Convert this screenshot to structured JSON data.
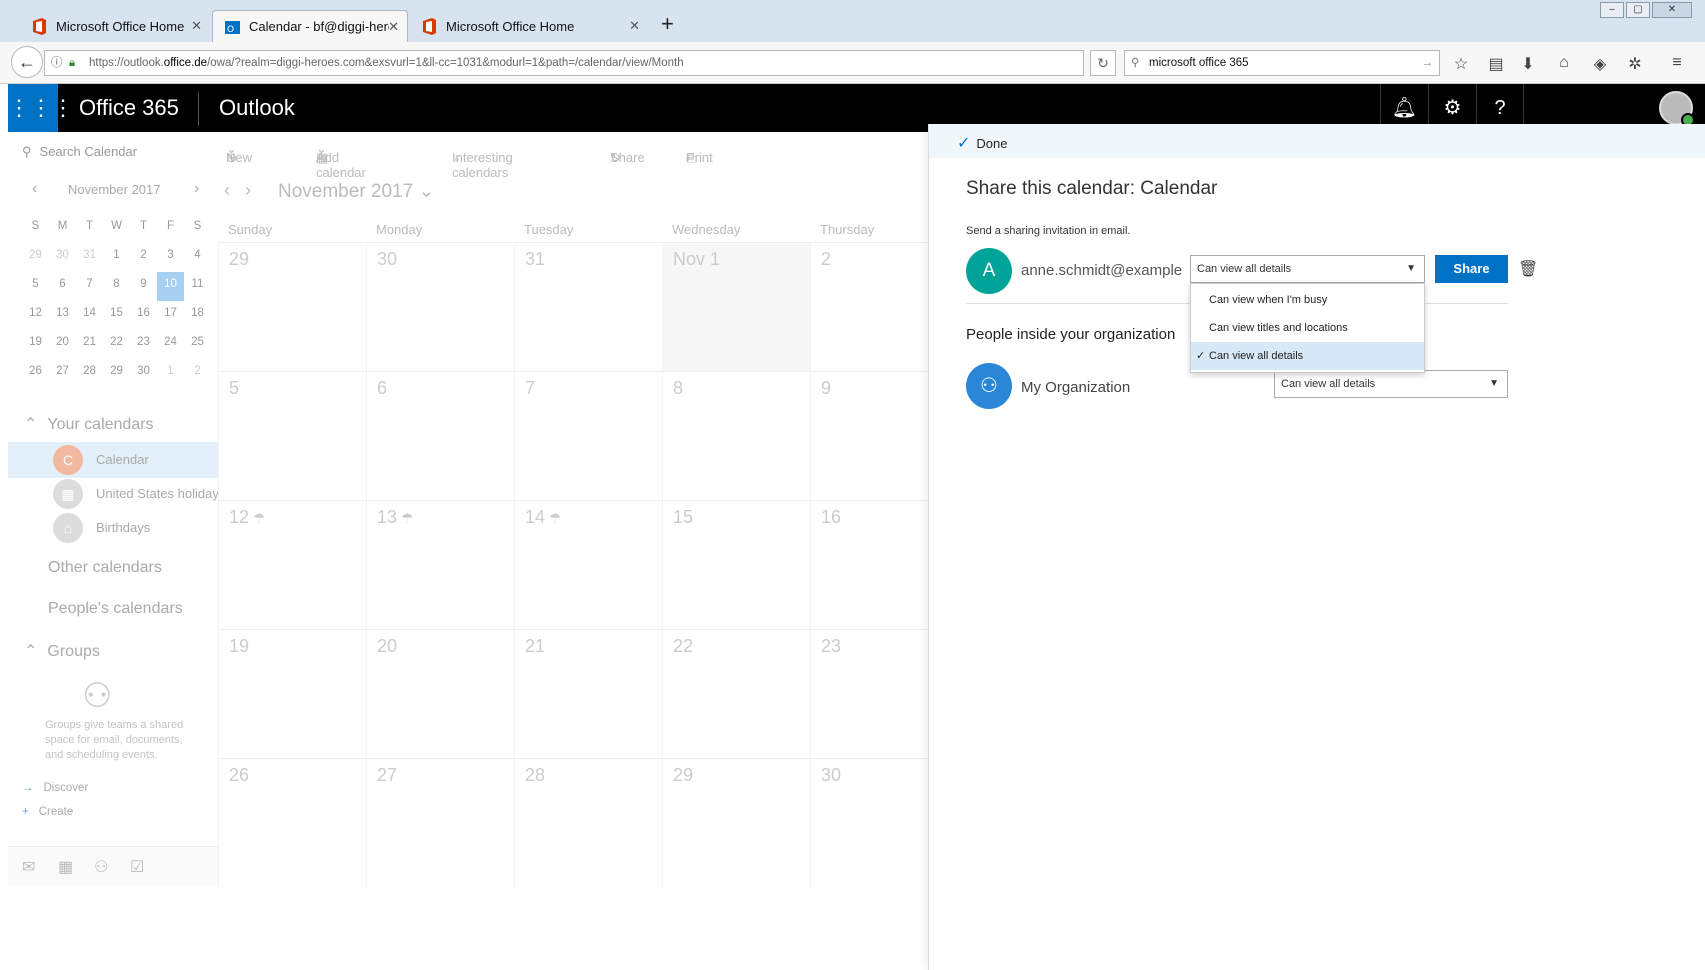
{
  "browser": {
    "tabs": [
      {
        "title": "Microsoft Office Home"
      },
      {
        "title": "Calendar - bf@diggi-heroes.d"
      },
      {
        "title": "Microsoft Office Home"
      }
    ],
    "new_tab": "+",
    "url_host_prefix": "https://outlook.",
    "url_host_bold": "office.de",
    "url_rest": "/owa/?realm=diggi-heroes.com&exsvurl=1&ll-cc=1031&modurl=1&path=/calendar/view/Month",
    "search_value": "microsoft office 365"
  },
  "suite": {
    "brand": "Office 365",
    "app": "Outlook"
  },
  "left": {
    "search_placeholder": "Search Calendar",
    "mini_month": "November 2017",
    "weekday_letters": [
      "S",
      "M",
      "T",
      "W",
      "T",
      "F",
      "S"
    ],
    "mini_days": [
      [
        "29",
        "30",
        "31",
        "1",
        "2",
        "3",
        "4"
      ],
      [
        "5",
        "6",
        "7",
        "8",
        "9",
        "10",
        "11"
      ],
      [
        "12",
        "13",
        "14",
        "15",
        "16",
        "17",
        "18"
      ],
      [
        "19",
        "20",
        "21",
        "22",
        "23",
        "24",
        "25"
      ],
      [
        "26",
        "27",
        "28",
        "29",
        "30",
        "1",
        "2"
      ]
    ],
    "today": "10",
    "your_calendars": "Your calendars",
    "calendars": [
      {
        "label": "Calendar",
        "initial": "C",
        "color": "#e8602c"
      },
      {
        "label": "United States holiday",
        "initial": "",
        "color": "#cccccc"
      },
      {
        "label": "Birthdays",
        "initial": "",
        "color": "#cccccc"
      }
    ],
    "other_calendars": "Other calendars",
    "peoples_calendars": "People's calendars",
    "groups": "Groups",
    "groups_desc": "Groups give teams a shared space for email, documents, and scheduling events.",
    "discover": "Discover",
    "create": "Create"
  },
  "calendar": {
    "cmd_new": "New",
    "cmd_add": "Add calendar",
    "cmd_interesting": "Interesting calendars",
    "cmd_share": "Share",
    "cmd_print": "Print",
    "month_title": "November 2017",
    "day_names": [
      "Sunday",
      "Monday",
      "Tuesday",
      "Wednesday",
      "Thursday"
    ],
    "weeks": [
      [
        "29",
        "30",
        "31",
        "Nov 1",
        "2"
      ],
      [
        "5",
        "6",
        "7",
        "8",
        "9"
      ],
      [
        "12",
        "13",
        "14",
        "15",
        "16"
      ],
      [
        "19",
        "20",
        "21",
        "22",
        "23"
      ],
      [
        "26",
        "27",
        "28",
        "29",
        "30"
      ]
    ]
  },
  "share": {
    "done": "Done",
    "title": "Share this calendar: Calendar",
    "send_invitation": "Send a sharing invitation in email.",
    "person_initial": "A",
    "person_email": "anne.schmidt@example.com",
    "permission_selected": "Can view all details",
    "share_button": "Share",
    "options": [
      "Can view when I'm busy",
      "Can view titles and locations",
      "Can view all details"
    ],
    "people_inside": "People inside your organization",
    "org_name": "My Organization",
    "org_permission": "Can view all details"
  },
  "colors": {
    "brand_blue": "#0072c6",
    "person_avatar": "#00a398",
    "org_avatar": "#2a86d6"
  }
}
